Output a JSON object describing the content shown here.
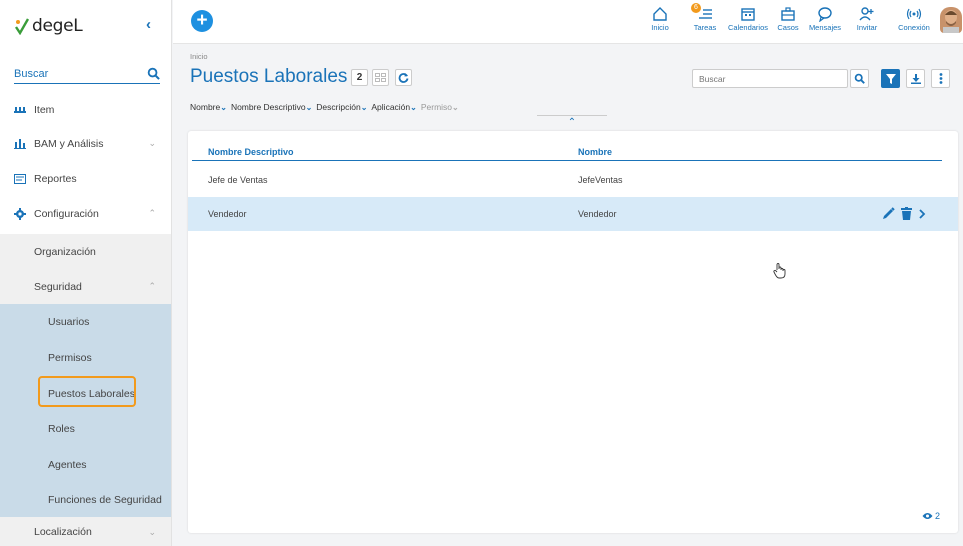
{
  "brand": {
    "name": "degeL"
  },
  "sidebar": {
    "collapse": "‹",
    "search_label": "Buscar",
    "items": [
      {
        "label": "Item"
      },
      {
        "label": "BAM y Análisis"
      },
      {
        "label": "Reportes"
      },
      {
        "label": "Configuración"
      },
      {
        "label": "Organización"
      },
      {
        "label": "Seguridad"
      },
      {
        "label": "Usuarios"
      },
      {
        "label": "Permisos"
      },
      {
        "label": "Puestos Laborales"
      },
      {
        "label": "Roles"
      },
      {
        "label": "Agentes"
      },
      {
        "label": "Funciones de Seguridad"
      },
      {
        "label": "Localización"
      }
    ]
  },
  "topnav": {
    "inicio": "Inicio",
    "tareas": "Tareas",
    "tareas_badge": "6",
    "calendarios": "Calendarios",
    "casos": "Casos",
    "mensajes": "Mensajes",
    "invitar": "Invitar",
    "conexion": "Conexión"
  },
  "page": {
    "breadcrumb": "Inicio",
    "title": "Puestos Laborales",
    "count": "2",
    "search_placeholder": "Buscar",
    "filters": [
      "Nombre",
      "Nombre Descriptivo",
      "Descripción",
      "Aplicación",
      "Permiso"
    ],
    "views_count": "2"
  },
  "table": {
    "columns": [
      "Nombre Descriptivo",
      "Nombre"
    ],
    "rows": [
      [
        "Jefe de Ventas",
        "JefeVentas"
      ],
      [
        "Vendedor",
        "Vendedor"
      ]
    ]
  },
  "colors": {
    "accent": "#1a73b8",
    "highlight": "#f29a1c",
    "selected_row": "#d7eaf8"
  }
}
